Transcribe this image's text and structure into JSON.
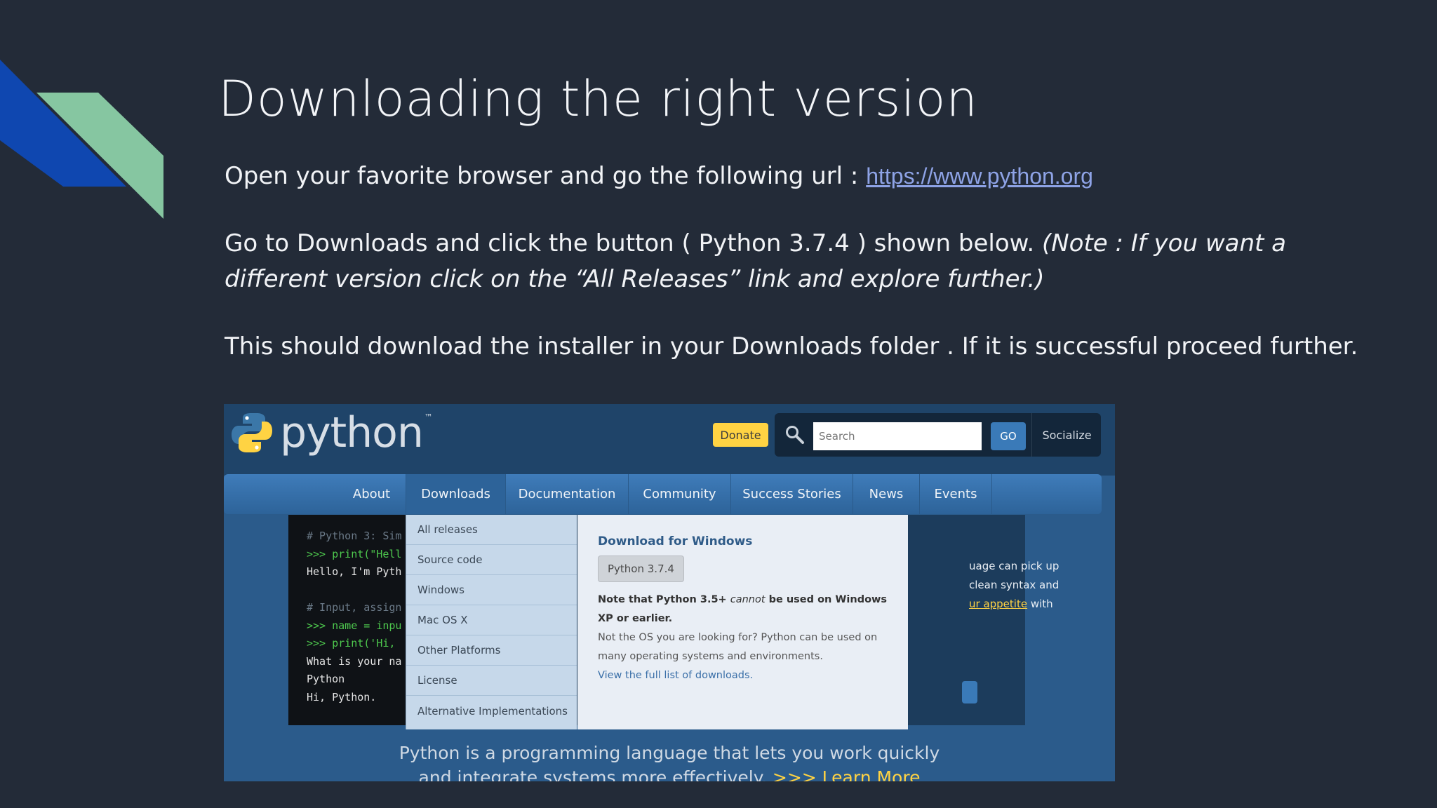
{
  "slide": {
    "title": "Downloading the right version",
    "p1_text": "Open your favorite browser and go the following url : ",
    "p1_link": "https://www.python.org",
    "p2_text": "Go to Downloads and click the button ( Python 3.7.4 ) shown below.  ",
    "p2_note": "(Note : If you want a different version click on the “All Releases” link and explore further.)",
    "p3_text": "This should download the installer in your Downloads folder . If it is successful proceed further."
  },
  "site": {
    "logo_text": "python",
    "logo_tm": "™",
    "donate": "Donate",
    "search_placeholder": "Search",
    "go": "GO",
    "socialize": "Socialize",
    "nav": [
      "About",
      "Downloads",
      "Documentation",
      "Community",
      "Success Stories",
      "News",
      "Events"
    ],
    "dropdown": [
      "All releases",
      "Source code",
      "Windows",
      "Mac OS X",
      "Other Platforms",
      "License",
      "Alternative Implementations"
    ],
    "console": [
      "# Python 3: Sim",
      ">>> print(\"Hell",
      "Hello, I'm Pyth",
      "",
      "# Input, assign",
      ">>> name = inpu",
      ">>> print('Hi,",
      "What is your na",
      "Python",
      "Hi, Python."
    ],
    "blurb_line1": "uage can pick up",
    "blurb_line2": "clean syntax and",
    "blurb_link": "ur appetite",
    "blurb_after": " with",
    "panel": {
      "title": "Download for Windows",
      "button": "Python 3.7.4",
      "note_pre": "Note that Python 3.5+ ",
      "note_em": "cannot",
      "note_post": " be used on Windows XP or earlier.",
      "text": "Not the OS you are looking for? Python can be used on many operating systems and environments.",
      "link": "View the full list of downloads."
    },
    "tagline_1": "Python is a programming language that lets you work quickly",
    "tagline_2": "and integrate systems more effectively.",
    "learn_more": ">>> Learn More"
  }
}
